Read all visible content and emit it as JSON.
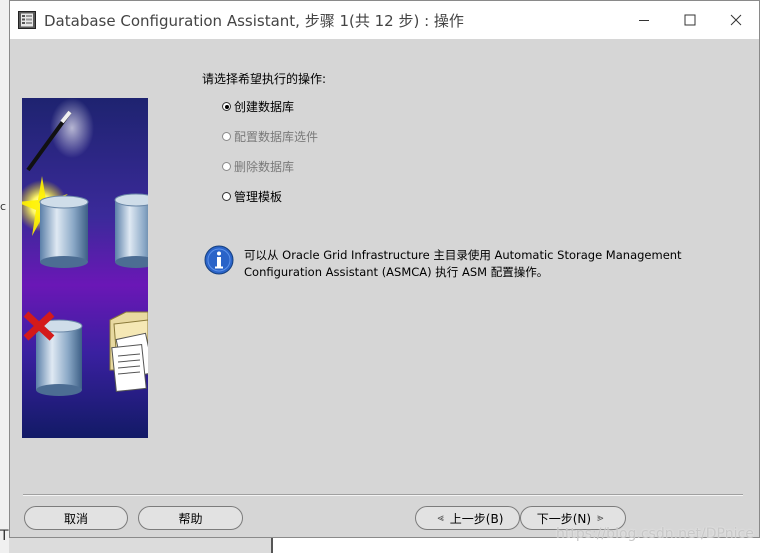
{
  "window": {
    "title": "Database Configuration Assistant, 步骤 1(共 12 步) : 操作",
    "controls": {
      "minimize": "minimize-icon",
      "maximize": "maximize-icon",
      "close": "close-icon"
    }
  },
  "main": {
    "prompt": "请选择希望执行的操作:",
    "options": [
      {
        "label": "创建数据库",
        "selected": true,
        "enabled": true
      },
      {
        "label": "配置数据库选件",
        "selected": false,
        "enabled": false
      },
      {
        "label": "删除数据库",
        "selected": false,
        "enabled": false
      },
      {
        "label": "管理模板",
        "selected": false,
        "enabled": true
      }
    ],
    "info": "可以从 Oracle Grid Infrastructure 主目录使用 Automatic Storage Management Configuration Assistant (ASMCA) 执行 ASM 配置操作。"
  },
  "footer": {
    "cancel": "取消",
    "help": "帮助",
    "back": "上一步(B)",
    "next": "下一步(N)"
  },
  "background": {
    "peek_left_char": "c",
    "peek_bottom_char": "T"
  },
  "watermark": "https://blog.csdn.net/DPnice",
  "colors": {
    "dialog_bg": "#d6d6d6",
    "art_sky_top": "#1a1c6e",
    "art_sky_mid": "#5a14a8",
    "info_blue": "#2a63c8"
  }
}
